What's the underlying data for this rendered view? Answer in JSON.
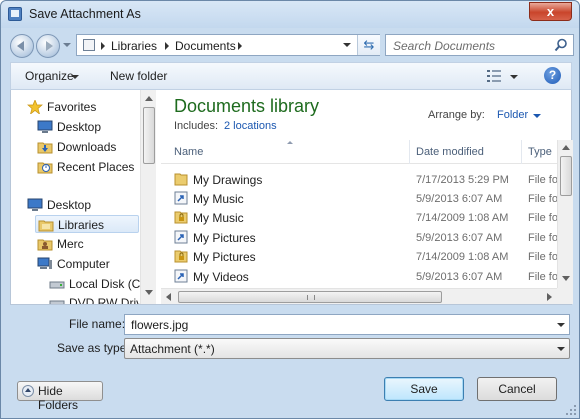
{
  "window": {
    "title": "Save Attachment As",
    "close_label": "x"
  },
  "address": {
    "crumbs": [
      "Libraries",
      "Documents"
    ],
    "refresh_glyph": "⇆"
  },
  "search": {
    "placeholder": "Search Documents"
  },
  "toolbar": {
    "organize_label": "Organize",
    "new_folder_label": "New folder",
    "help_glyph": "?"
  },
  "nav": {
    "items": [
      {
        "label": "Favorites",
        "icon": "star-icon"
      },
      {
        "label": "Desktop",
        "icon": "desktop-icon"
      },
      {
        "label": "Downloads",
        "icon": "downloads-icon"
      },
      {
        "label": "Recent Places",
        "icon": "recent-places-icon"
      },
      {
        "label": "Desktop",
        "icon": "desktop-icon"
      },
      {
        "label": "Libraries",
        "icon": "libraries-icon",
        "selected": true
      },
      {
        "label": "Merc",
        "icon": "user-icon"
      },
      {
        "label": "Computer",
        "icon": "computer-icon"
      },
      {
        "label": "Local Disk (C:)",
        "icon": "drive-icon"
      },
      {
        "label": "DVD RW Drive (",
        "icon": "dvd-drive-icon"
      }
    ]
  },
  "library": {
    "title": "Documents library",
    "includes_label": "Includes:",
    "includes_link": "2 locations",
    "arrange_label": "Arrange by:",
    "arrange_value": "Folder"
  },
  "columns": {
    "name": "Name",
    "date": "Date modified",
    "type": "Type"
  },
  "files": [
    {
      "name": "My Drawings",
      "date": "7/17/2013 5:29 PM",
      "type": "File fol",
      "icon": "folder-icon"
    },
    {
      "name": "My Music",
      "date": "5/9/2013 6:07 AM",
      "type": "File fol",
      "icon": "shortcut-folder-icon"
    },
    {
      "name": "My Music",
      "date": "7/14/2009 1:08 AM",
      "type": "File fol",
      "icon": "locked-folder-icon"
    },
    {
      "name": "My Pictures",
      "date": "5/9/2013 6:07 AM",
      "type": "File fol",
      "icon": "shortcut-folder-icon"
    },
    {
      "name": "My Pictures",
      "date": "7/14/2009 1:08 AM",
      "type": "File fol",
      "icon": "locked-folder-icon"
    },
    {
      "name": "My Videos",
      "date": "5/9/2013 6:07 AM",
      "type": "File fol",
      "icon": "shortcut-folder-icon"
    }
  ],
  "form": {
    "file_name_label": "File name:",
    "file_name_value": "flowers.jpg",
    "save_type_label": "Save as type:",
    "save_type_value": "Attachment (*.*)"
  },
  "buttons": {
    "hide_folders": "Hide Folders",
    "save": "Save",
    "cancel": "Cancel"
  },
  "colors": {
    "library_title": "#1e6b1e",
    "link": "#1b57b0",
    "selection": "#dbe9f8"
  }
}
